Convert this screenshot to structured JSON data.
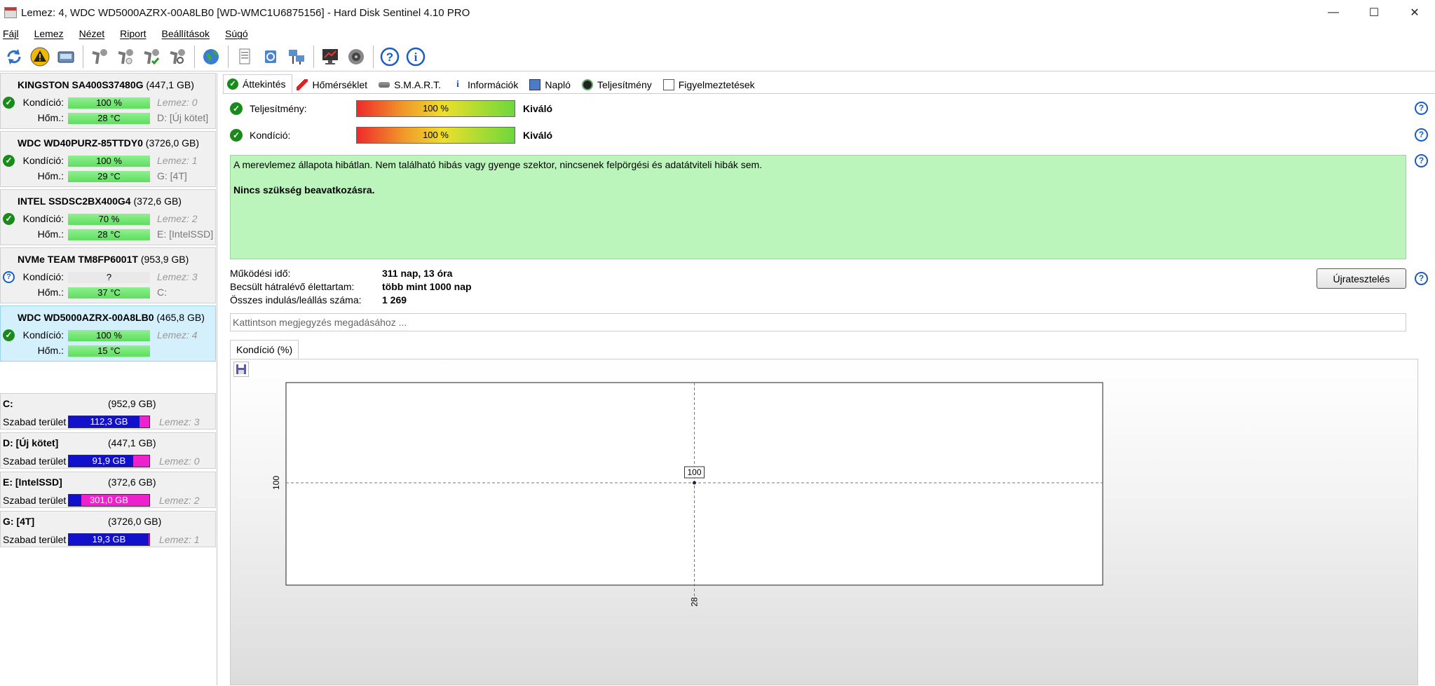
{
  "window": {
    "title": "Lemez: 4, WDC WD5000AZRX-00A8LB0 [WD-WMC1U6875156]  -  Hard Disk Sentinel 4.10 PRO",
    "minimize": "—",
    "maximize": "☐",
    "close": "✕"
  },
  "menu": [
    "Fájl",
    "Lemez",
    "Nézet",
    "Riport",
    "Beállítások",
    "Súgó"
  ],
  "toolbar": {
    "icons": [
      "refresh-icon",
      "alert-icon",
      "disk-icon",
      "wrench-icon",
      "wrench-check-icon",
      "wrench-test-icon",
      "wrench-magnify-icon",
      "globe-icon",
      "report-icon",
      "sync-icon",
      "network-icon",
      "monitor-icon",
      "speaker-icon",
      "help-icon",
      "info-icon"
    ]
  },
  "disks": [
    {
      "name": "KINGSTON SA400S37480G",
      "size": "(447,1 GB)",
      "status": "ok",
      "health_label": "Kondíció:",
      "health": "100 %",
      "health_level": 100,
      "temp_label": "Hőm.:",
      "temp": "28 °C",
      "disk_id": "Lemez: 0",
      "drives": "D: [Új kötet]"
    },
    {
      "name": "WDC WD40PURZ-85TTDY0",
      "size": "(3726,0 GB)",
      "status": "ok",
      "health_label": "Kondíció:",
      "health": "100 %",
      "health_level": 100,
      "temp_label": "Hőm.:",
      "temp": "29 °C",
      "disk_id": "Lemez: 1",
      "drives": "G: [4T]"
    },
    {
      "name": "INTEL SSDSC2BX400G4",
      "size": "(372,6 GB)",
      "status": "ok",
      "health_label": "Kondíció:",
      "health": "70 %",
      "health_level": 70,
      "temp_label": "Hőm.:",
      "temp": "28 °C",
      "disk_id": "Lemez: 2",
      "drives": "E: [IntelSSD]"
    },
    {
      "name": "NVMe    TEAM TM8FP6001T",
      "size": "(953,9 GB)",
      "status": "unknown",
      "health_label": "Kondíció:",
      "health": "?",
      "health_level": null,
      "temp_label": "Hőm.:",
      "temp": "37 °C",
      "disk_id": "Lemez: 3",
      "drives": "C:"
    },
    {
      "name": "WDC WD5000AZRX-00A8LB0",
      "size": "(465,8 GB)",
      "status": "ok",
      "health_label": "Kondíció:",
      "health": "100 %",
      "health_level": 100,
      "temp_label": "Hőm.:",
      "temp": "15 °C",
      "disk_id": "Lemez: 4",
      "drives": ""
    }
  ],
  "volumes": [
    {
      "name": "C:",
      "size": "(952,9 GB)",
      "label": "Szabad terület",
      "free": "112,3 GB",
      "free_fraction": 0.88,
      "disk": "Lemez: 3"
    },
    {
      "name": "D: [Új kötet]",
      "size": "(447,1 GB)",
      "label": "Szabad terület",
      "free": "91,9 GB",
      "free_fraction": 0.8,
      "disk": "Lemez: 0"
    },
    {
      "name": "E: [IntelSSD]",
      "size": "(372,6 GB)",
      "label": "Szabad terület",
      "free": "301,0 GB",
      "free_fraction": 0.16,
      "disk": "Lemez: 2"
    },
    {
      "name": "G: [4T]",
      "size": "(3726,0 GB)",
      "label": "Szabad terület",
      "free": "19,3 GB",
      "free_fraction": 0.99,
      "disk": "Lemez: 1"
    }
  ],
  "tabs": [
    "Áttekintés",
    "Hőmérséklet",
    "S.M.A.R.T.",
    "Információk",
    "Napló",
    "Teljesítmény",
    "Figyelmeztetések"
  ],
  "overview": {
    "performance_label": "Teljesítmény:",
    "performance": "100 %",
    "performance_level": 100,
    "performance_rating": "Kiváló",
    "health_label": "Kondíció:",
    "health": "100 %",
    "health_level": 100,
    "health_rating": "Kiváló",
    "status_text": "A merevlemez állapota hibátlan. Nem található hibás vagy gyenge szektor, nincsenek felpörgési és adatátviteli hibák sem.",
    "status_action": "Nincs szükség beavatkozásra.",
    "uptime_label": "Működési idő:",
    "uptime": "311 nap, 13 óra",
    "lifetime_label": "Becsült hátralévő élettartam:",
    "lifetime": "több mint 1000 nap",
    "startstop_label": "Összes indulás/leállás száma:",
    "startstop": "1 269",
    "retest_button": "Újratesztelés",
    "note_placeholder": "Kattintson megjegyzés megadásához ...",
    "chart_tab": "Kondíció  (%)"
  },
  "help_symbol": "?",
  "chart_data": {
    "type": "line",
    "x": [
      "28"
    ],
    "series": [
      {
        "values": [
          100
        ]
      }
    ],
    "data_labels": [
      "100"
    ],
    "xlabel": "",
    "ylabel": "",
    "y_tick_labels": [
      "100"
    ],
    "x_tick_labels": [
      "28"
    ],
    "grid": true
  }
}
